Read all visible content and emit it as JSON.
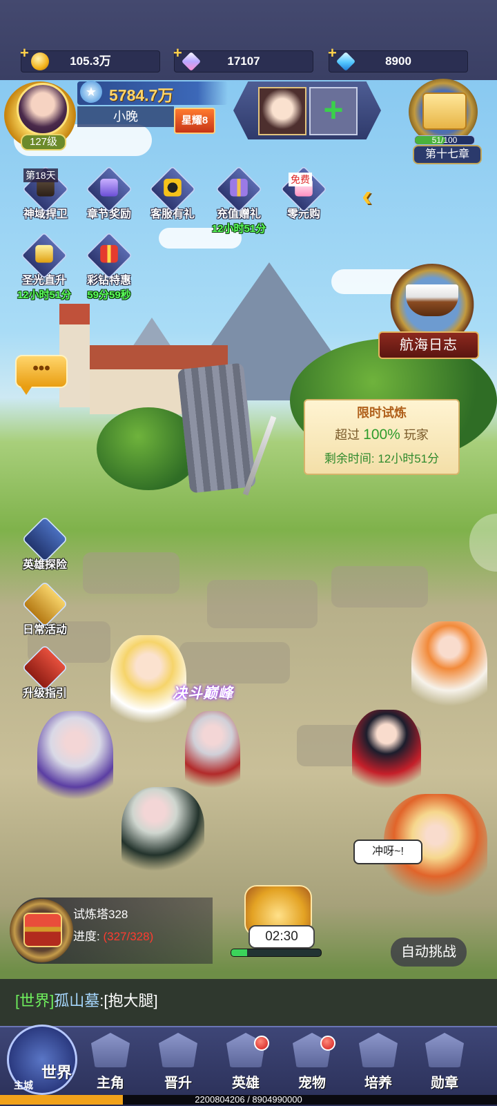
{
  "resources": [
    {
      "icon": "gold-coin-icon",
      "value": "105.3万"
    },
    {
      "icon": "crystal-icon",
      "value": "17107"
    },
    {
      "icon": "diamond-icon",
      "value": "8900"
    }
  ],
  "player": {
    "level": "127级",
    "power": "5784.7万",
    "name": "小晚",
    "star_badge": "星耀8"
  },
  "chapter": {
    "progress_text": "51/100",
    "progress_fraction": 0.51,
    "label": "第十七章"
  },
  "functions_row1": [
    {
      "label": "神域捍卫",
      "tag": "第18天"
    },
    {
      "label": "章节奖励"
    },
    {
      "label": "客服有礼"
    },
    {
      "label": "充值赠礼",
      "timer": "12小时51分"
    },
    {
      "label": "零元购",
      "tag": "免费"
    }
  ],
  "functions_row2": [
    {
      "label": "圣光直升",
      "timer": "12小时51分"
    },
    {
      "label": "彩钻特惠",
      "timer": "59分59秒"
    }
  ],
  "voyage": {
    "label": "航海日志"
  },
  "trial": {
    "title": "限时试炼",
    "beat_prefix": "超过",
    "beat_pct": "100%",
    "beat_suffix": "玩家",
    "remain_label": "剩余时间:",
    "remain_value": "12小时51分"
  },
  "side_buttons": [
    {
      "label": "英雄探险"
    },
    {
      "label": "日常活动"
    },
    {
      "label": "升级指引"
    }
  ],
  "battle": {
    "event_label": "决斗巅峰",
    "speech": "冲呀~!"
  },
  "tower": {
    "name": "试炼塔328",
    "progress_label": "进度:",
    "progress_value": "(327/328)"
  },
  "treasure": {
    "countdown": "02:30",
    "bar_fraction": 0.18
  },
  "auto_button": "自动挑战",
  "chat": {
    "channel": "[世界]",
    "user": "孤山墓",
    "text": ":[抱大腿]"
  },
  "nav": {
    "home_world": "世界",
    "home_city": "主城",
    "items": [
      {
        "label": "主角",
        "badge": false
      },
      {
        "label": "晋升",
        "badge": false
      },
      {
        "label": "英雄",
        "badge": true
      },
      {
        "label": "宠物",
        "badge": true
      },
      {
        "label": "培养",
        "badge": false
      },
      {
        "label": "勋章",
        "badge": false
      }
    ]
  },
  "footer": {
    "text": "2200804206 / 8904990000",
    "fraction": 0.247
  },
  "colors": {
    "accent_gold": "#ffd56a",
    "timer_green": "#5cff5c",
    "alert_red": "#ff3b2f",
    "nav_bg": "#2a2f57"
  }
}
